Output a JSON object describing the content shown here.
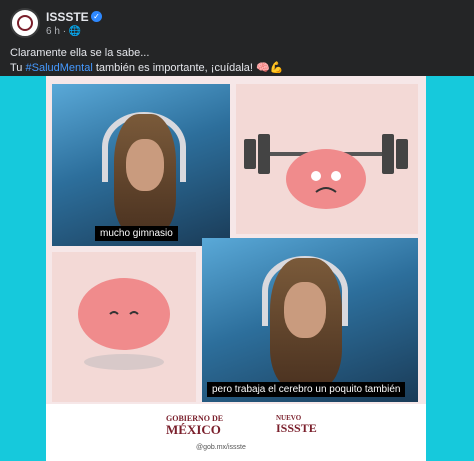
{
  "post": {
    "page_name": "ISSSTE",
    "time": "6 h",
    "caption_line1": "Claramente ella se la sabe...",
    "caption_prefix": "Tu ",
    "hashtag": "#SaludMental",
    "caption_suffix": " también es importante, ¡cuídala! 🧠💪"
  },
  "media": {
    "subtitle_top": "mucho gimnasio",
    "subtitle_bottom": "pero trabaja el cerebro un poquito también",
    "logo_left_line1": "GOBIERNO DE",
    "logo_left_line2": "MÉXICO",
    "logo_right_line1": "NUEVO",
    "logo_right_line2": "ISSSTE",
    "social": "@gob.mx/issste"
  },
  "colors": {
    "background": "#242526",
    "media_background": "#16c9dc",
    "hashtag": "#4599ff"
  }
}
